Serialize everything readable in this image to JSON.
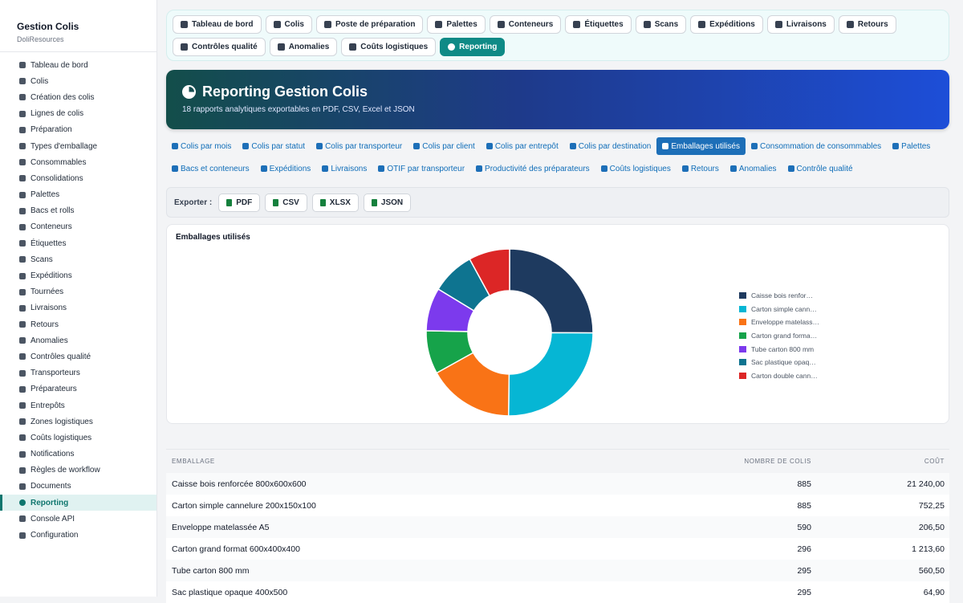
{
  "sidebar": {
    "title": "Gestion Colis",
    "subtitle": "DoliResources",
    "items": [
      {
        "label": "Tableau de bord",
        "icon": "dashboard-icon"
      },
      {
        "label": "Colis",
        "icon": "box-icon"
      },
      {
        "label": "Création des colis",
        "icon": "plus-square-icon"
      },
      {
        "label": "Lignes de colis",
        "icon": "list-icon"
      },
      {
        "label": "Préparation",
        "icon": "dolly-icon"
      },
      {
        "label": "Types d'emballage",
        "icon": "boxes-icon"
      },
      {
        "label": "Consommables",
        "icon": "tape-icon"
      },
      {
        "label": "Consolidations",
        "icon": "layer-group-icon"
      },
      {
        "label": "Palettes",
        "icon": "pallet-icon"
      },
      {
        "label": "Bacs et rolls",
        "icon": "bin-icon"
      },
      {
        "label": "Conteneurs",
        "icon": "container-icon"
      },
      {
        "label": "Étiquettes",
        "icon": "tag-icon"
      },
      {
        "label": "Scans",
        "icon": "barcode-icon"
      },
      {
        "label": "Expéditions",
        "icon": "truck-icon"
      },
      {
        "label": "Tournées",
        "icon": "route-icon"
      },
      {
        "label": "Livraisons",
        "icon": "delivery-icon"
      },
      {
        "label": "Retours",
        "icon": "undo-icon"
      },
      {
        "label": "Anomalies",
        "icon": "warning-icon"
      },
      {
        "label": "Contrôles qualité",
        "icon": "clipboard-check-icon"
      },
      {
        "label": "Transporteurs",
        "icon": "carrier-icon"
      },
      {
        "label": "Préparateurs",
        "icon": "users-icon"
      },
      {
        "label": "Entrepôts",
        "icon": "warehouse-icon"
      },
      {
        "label": "Zones logistiques",
        "icon": "grid-icon"
      },
      {
        "label": "Coûts logistiques",
        "icon": "coins-icon"
      },
      {
        "label": "Notifications",
        "icon": "bell-icon"
      },
      {
        "label": "Règles de workflow",
        "icon": "cogs-icon"
      },
      {
        "label": "Documents",
        "icon": "paperclip-icon"
      },
      {
        "label": "Reporting",
        "icon": "chart-pie-icon",
        "active": true
      },
      {
        "label": "Console API",
        "icon": "plug-icon"
      },
      {
        "label": "Configuration",
        "icon": "gear-icon"
      }
    ]
  },
  "topnav": {
    "row1": [
      {
        "label": "Tableau de bord",
        "icon": "dashboard-icon"
      },
      {
        "label": "Colis",
        "icon": "box-icon"
      },
      {
        "label": "Poste de préparation",
        "icon": "dolly-icon"
      },
      {
        "label": "Palettes",
        "icon": "pallet-icon"
      },
      {
        "label": "Conteneurs",
        "icon": "container-icon"
      },
      {
        "label": "Étiquettes",
        "icon": "tag-icon"
      },
      {
        "label": "Scans",
        "icon": "barcode-icon"
      },
      {
        "label": "Expéditions",
        "icon": "truck-icon"
      },
      {
        "label": "Livraisons",
        "icon": "delivery-icon"
      },
      {
        "label": "Retours",
        "icon": "undo-icon"
      }
    ],
    "row2": [
      {
        "label": "Contrôles qualité",
        "icon": "clipboard-check-icon"
      },
      {
        "label": "Anomalies",
        "icon": "warning-icon"
      },
      {
        "label": "Coûts logistiques",
        "icon": "coins-icon"
      },
      {
        "label": "Reporting",
        "icon": "chart-pie-icon",
        "active": true
      }
    ]
  },
  "hero": {
    "title": "Reporting Gestion Colis",
    "subtitle": "18 rapports analytiques exportables en PDF, CSV, Excel et JSON"
  },
  "reports": [
    {
      "label": "Colis par mois",
      "icon": "calendar-icon"
    },
    {
      "label": "Colis par statut",
      "icon": "list-icon"
    },
    {
      "label": "Colis par transporteur",
      "icon": "truck-icon"
    },
    {
      "label": "Colis par client",
      "icon": "building-icon"
    },
    {
      "label": "Colis par entrepôt",
      "icon": "warehouse-icon"
    },
    {
      "label": "Colis par destination",
      "icon": "map-marker-icon"
    },
    {
      "label": "Emballages utilisés",
      "icon": "boxes-icon",
      "active": true
    },
    {
      "label": "Consommation de consommables",
      "icon": "tape-icon"
    },
    {
      "label": "Palettes",
      "icon": "pallet-icon"
    },
    {
      "label": "Bacs et conteneurs",
      "icon": "container-icon"
    },
    {
      "label": "Expéditions",
      "icon": "truck-icon"
    },
    {
      "label": "Livraisons",
      "icon": "delivery-icon"
    },
    {
      "label": "OTIF par transporteur",
      "icon": "target-icon"
    },
    {
      "label": "Productivité des préparateurs",
      "icon": "gauge-icon"
    },
    {
      "label": "Coûts logistiques",
      "icon": "coins-icon"
    },
    {
      "label": "Retours",
      "icon": "undo-icon"
    },
    {
      "label": "Anomalies",
      "icon": "warning-icon"
    },
    {
      "label": "Contrôle qualité",
      "icon": "clipboard-check-icon"
    }
  ],
  "export": {
    "label": "Exporter :",
    "buttons": [
      "PDF",
      "CSV",
      "XLSX",
      "JSON"
    ]
  },
  "chart_data": {
    "type": "pie",
    "title": "Emballages utilisés",
    "donut": true,
    "legend_position": "right",
    "categories": [
      "Caisse bois renfor…",
      "Carton simple cann…",
      "Enveloppe matelass…",
      "Carton grand forma…",
      "Tube carton 800 mm",
      "Sac plastique opaq…",
      "Carton double cann…"
    ],
    "values": [
      885,
      885,
      590,
      296,
      295,
      295,
      280
    ],
    "colors": [
      "#1e3a5f",
      "#06b6d4",
      "#f97316",
      "#16a34a",
      "#7c3aed",
      "#0e7490",
      "#dc2626"
    ]
  },
  "table": {
    "headers": [
      "Emballage",
      "Nombre de colis",
      "Coût"
    ],
    "rows": [
      [
        "Caisse bois renforcée 800x600x600",
        "885",
        "21 240,00"
      ],
      [
        "Carton simple cannelure 200x150x100",
        "885",
        "752,25"
      ],
      [
        "Enveloppe matelassée A5",
        "590",
        "206,50"
      ],
      [
        "Carton grand format 600x400x400",
        "296",
        "1 213,60"
      ],
      [
        "Tube carton 800 mm",
        "295",
        "560,50"
      ],
      [
        "Sac plastique opaque 400x500",
        "295",
        "64,90"
      ]
    ]
  }
}
